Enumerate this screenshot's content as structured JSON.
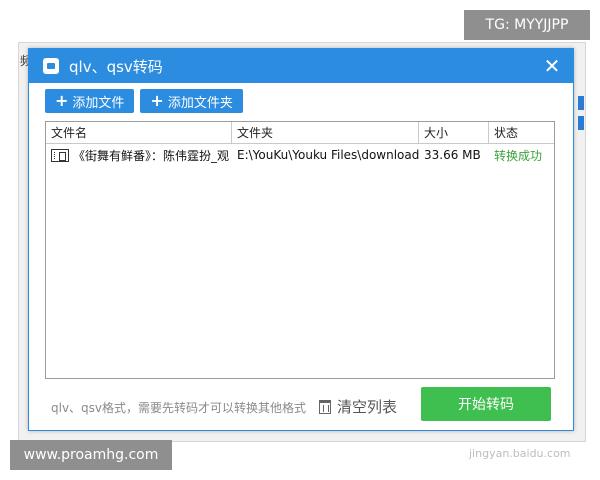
{
  "background": {
    "left_char": "频"
  },
  "dialog": {
    "title": "qlv、qsv转码",
    "close_glyph": "✕"
  },
  "toolbar": {
    "add_file_label": "添加文件",
    "add_folder_label": "添加文件夹"
  },
  "table": {
    "columns": [
      "文件名",
      "文件夹",
      "大小",
      "状态"
    ],
    "rows": [
      {
        "name": "《街舞有鲜番》：陈伟霆扮_观",
        "folder": "E:\\YouKu\\Youku Files\\download",
        "size": "33.66 MB",
        "status": "转换成功"
      }
    ]
  },
  "footer": {
    "note": "qlv、qsv格式，需要先转码才可以转换其他格式",
    "clear_label": "清空列表",
    "convert_label": "开始转码"
  },
  "overlays": {
    "tg": "TG: MYYJJPP",
    "site": "www.proamhg.com",
    "watermark": "jingyan.baidu.com"
  },
  "colors": {
    "accent": "#2b8ce0",
    "success": "#3aa33a",
    "convert": "#3fbf4f"
  }
}
